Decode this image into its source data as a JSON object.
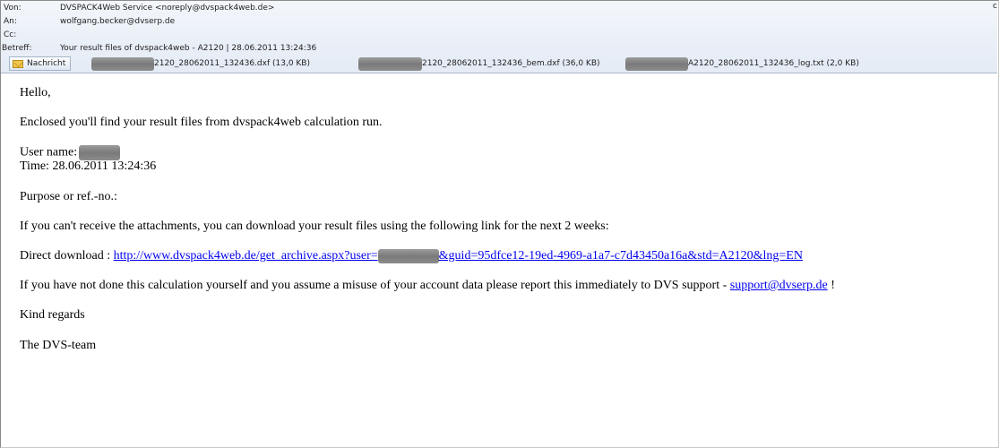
{
  "header": {
    "from_label": "Von:",
    "from_value": "DVSPACK4Web Service <noreply@dvspack4web.de>",
    "to_label": "An:",
    "to_value": "wolfgang.becker@dvserp.de",
    "cc_label": "Cc:",
    "cc_value": "",
    "subject_label": "Betreff:",
    "subject_value": "Your result files of dvspack4web - A2120 | 28.06.2011 13:24:36",
    "cut_char": "c"
  },
  "attachments": {
    "message_tab": "Nachricht",
    "files": [
      {
        "name": "2120_28062011_132436.dxf (13,0 KB)"
      },
      {
        "name": "2120_28062011_132436_bem.dxf (36,0 KB)"
      },
      {
        "name": "A2120_28062011_132436_log.txt (2,0 KB)"
      }
    ]
  },
  "body": {
    "greeting": "Hello,",
    "intro": "Enclosed you'll find your result files from dvspack4web calculation run.",
    "user_label": "User name:",
    "time_line": "Time: 28.06.2011 13:24:36",
    "purpose": "Purpose or ref.-no.:",
    "download_info": "If you can't receive the attachments, you can download your result files using the following link for the next 2 weeks:",
    "direct_label": "Direct download : ",
    "link_part1": "http://www.dvspack4web.de/get_archive.aspx?user=",
    "link_part2": "&guid=95dfce12-19ed-4969-a1a7-c7d43450a16a&std=A2120&lng=EN",
    "misuse_text": "If you have not done this calculation yourself and you assume a misuse of your account data please report this immediately to DVS support - ",
    "support_email": "support@dvserp.de",
    "misuse_end": " !",
    "regards": "Kind regards",
    "team": "The DVS-team"
  },
  "colors": {
    "link": "#0000ee",
    "header_bg": "#e4ebf5",
    "redaction": "#8a8a8a"
  }
}
